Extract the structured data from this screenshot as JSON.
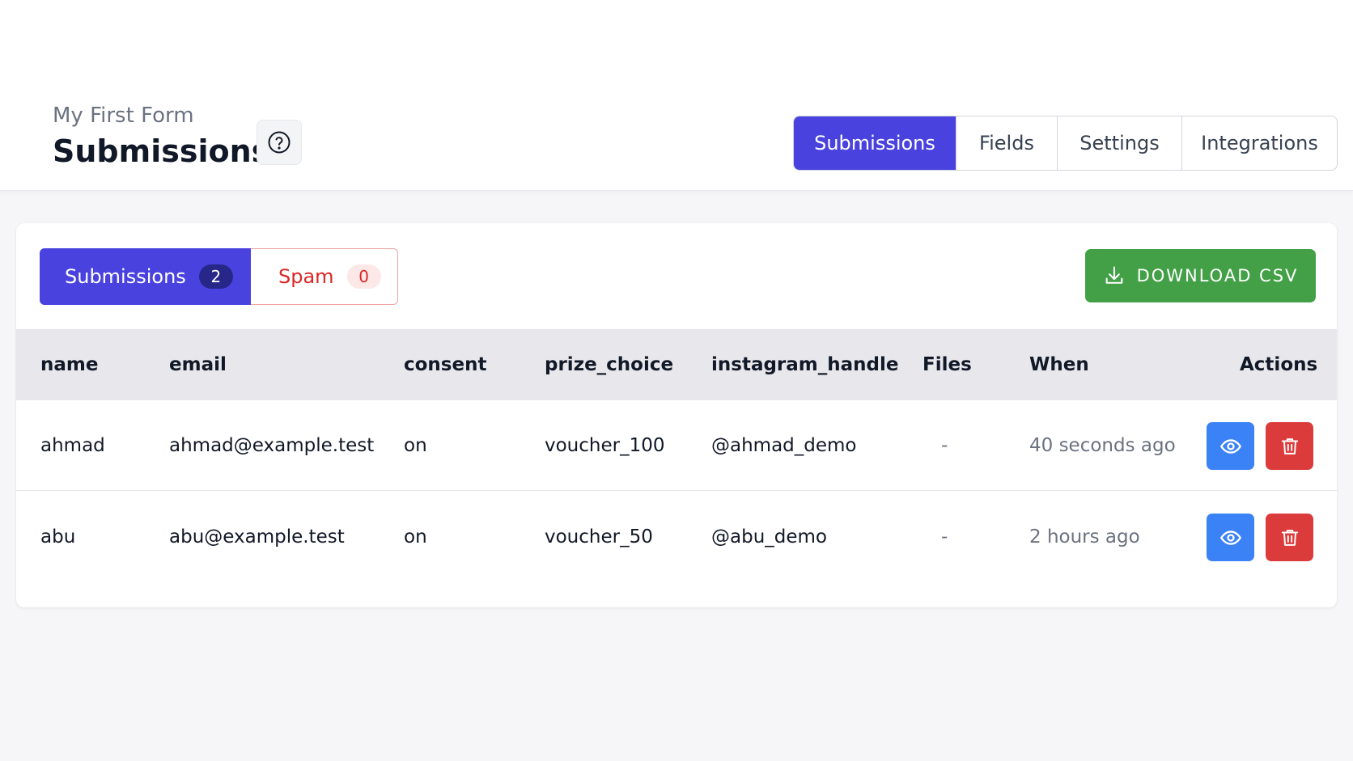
{
  "header": {
    "form_name": "My First Form",
    "title": "Submissions",
    "help_icon": "question-circle-icon",
    "tabs": [
      {
        "label": "Submissions",
        "active": true
      },
      {
        "label": "Fields",
        "active": false
      },
      {
        "label": "Settings",
        "active": false
      },
      {
        "label": "Integrations",
        "active": false
      }
    ]
  },
  "filters": {
    "submissions": {
      "label": "Submissions",
      "count": "2"
    },
    "spam": {
      "label": "Spam",
      "count": "0"
    }
  },
  "download": {
    "label": "DOWNLOAD CSV",
    "icon": "download-icon"
  },
  "table": {
    "columns": [
      "name",
      "email",
      "consent",
      "prize_choice",
      "instagram_handle",
      "Files",
      "When",
      "Actions"
    ],
    "rows": [
      {
        "name": "ahmad",
        "email": "ahmad@example.test",
        "consent": "on",
        "prize_choice": "voucher_100",
        "instagram_handle": "@ahmad_demo",
        "files": "-",
        "when": "40 seconds ago"
      },
      {
        "name": "abu",
        "email": "abu@example.test",
        "consent": "on",
        "prize_choice": "voucher_50",
        "instagram_handle": "@abu_demo",
        "files": "-",
        "when": "2 hours ago"
      }
    ]
  },
  "colors": {
    "primary": "#4a42df",
    "success": "#43a047",
    "danger": "#dc3b3b",
    "info": "#3b82f6"
  }
}
